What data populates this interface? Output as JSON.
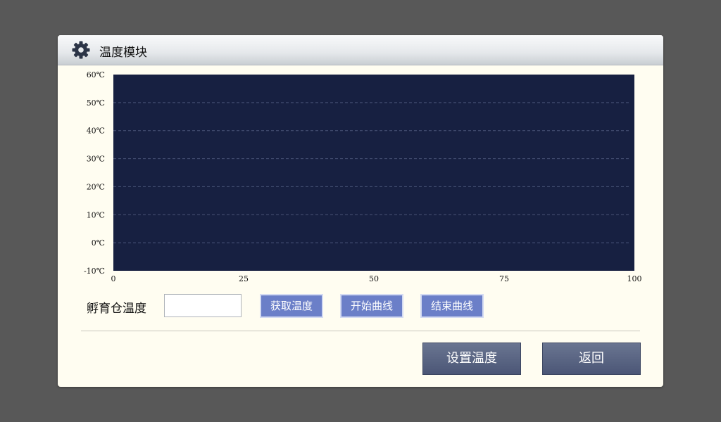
{
  "dialog": {
    "title": "温度模块",
    "icon": "gear-icon"
  },
  "chart_data": {
    "type": "line",
    "title": "",
    "xlabel": "",
    "ylabel": "",
    "x_ticks": [
      "0",
      "25",
      "50",
      "75",
      "100"
    ],
    "y_ticks": [
      "60℃",
      "50℃",
      "40℃",
      "30℃",
      "20℃",
      "10℃",
      "0℃",
      "-10℃"
    ],
    "xlim": [
      0,
      100
    ],
    "ylim": [
      -10,
      60
    ],
    "grid": true,
    "series": [],
    "plot_background": "#172041",
    "grid_color": "#4a5478"
  },
  "controls": {
    "temp_label": "孵育仓温度",
    "temp_value": "",
    "get_temp": "获取温度",
    "start_curve": "开始曲线",
    "end_curve": "结束曲线"
  },
  "footer": {
    "set_temp": "设置温度",
    "back": "返回"
  }
}
